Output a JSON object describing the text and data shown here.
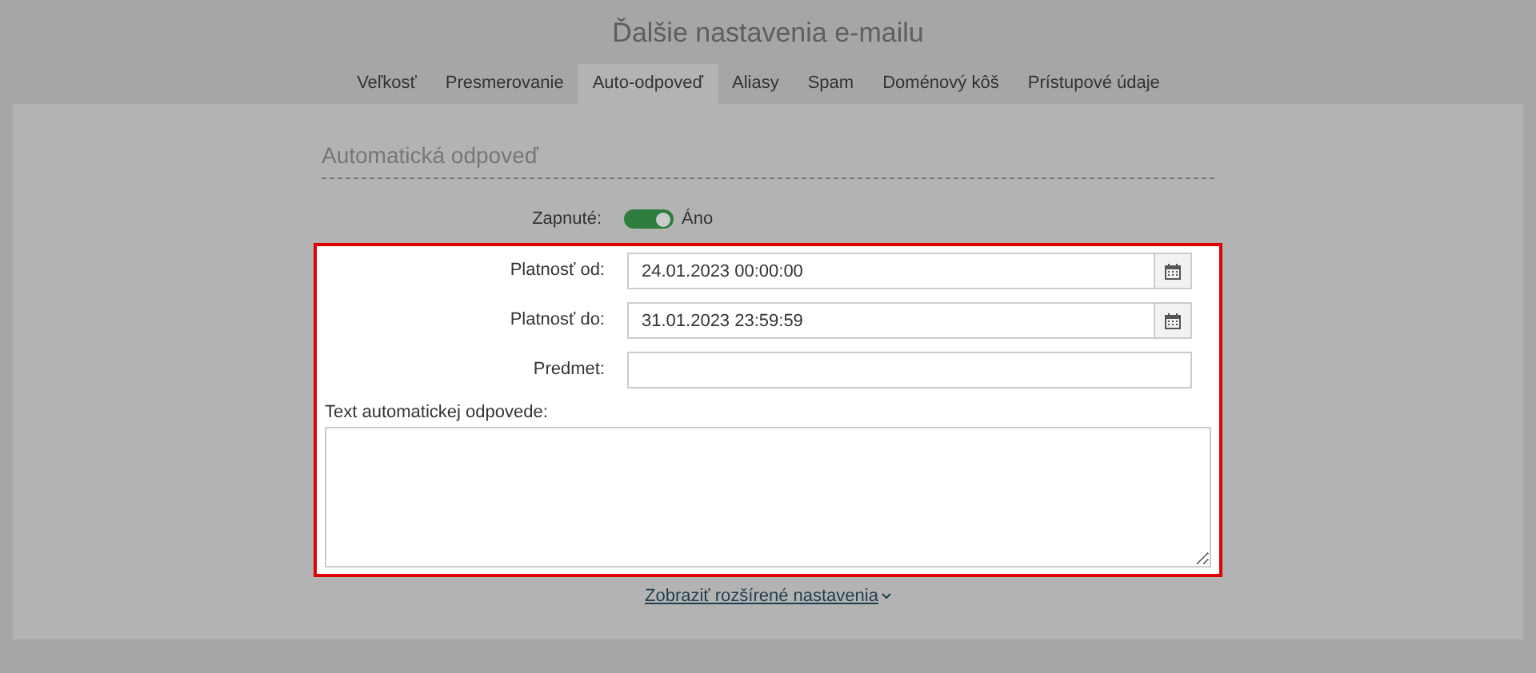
{
  "title": "Ďalšie nastavenia e-mailu",
  "tabs": [
    {
      "label": "Veľkosť",
      "selected": false
    },
    {
      "label": "Presmerovanie",
      "selected": false
    },
    {
      "label": "Auto-odpoveď",
      "selected": true
    },
    {
      "label": "Aliasy",
      "selected": false
    },
    {
      "label": "Spam",
      "selected": false
    },
    {
      "label": "Doménový kôš",
      "selected": false
    },
    {
      "label": "Prístupové údaje",
      "selected": false
    }
  ],
  "section_title": "Automatická odpoveď",
  "enabled": {
    "label": "Zapnuté:",
    "on": true,
    "value_label": "Áno"
  },
  "fields": [
    {
      "kind": "date",
      "label": "Platnosť od:",
      "value": "24.01.2023 00:00:00"
    },
    {
      "kind": "date",
      "label": "Platnosť do:",
      "value": "31.01.2023 23:59:59"
    },
    {
      "kind": "text",
      "label": "Predmet:"
    }
  ],
  "message": {
    "label": "Text automatickej odpovede:"
  },
  "advanced_link": "Zobraziť rozšírené nastavenia"
}
